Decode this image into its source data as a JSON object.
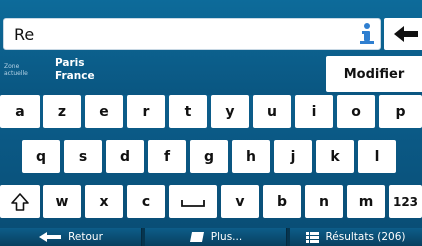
{
  "search": {
    "value": "Re"
  },
  "zone": {
    "label": "Zone actuelle",
    "city": "Paris",
    "country": "France"
  },
  "buttons": {
    "modify": "Modifier"
  },
  "keyboard": {
    "row1": [
      "a",
      "z",
      "e",
      "r",
      "t",
      "y",
      "u",
      "i",
      "o",
      "p"
    ],
    "row2": [
      "q",
      "s",
      "d",
      "f",
      "g",
      "h",
      "j",
      "k",
      "l"
    ],
    "row3": [
      "w",
      "x",
      "c",
      "v",
      "b",
      "n",
      "m"
    ],
    "numbers_key": "123"
  },
  "bottom_bar": {
    "back": "Retour",
    "more": "Plus...",
    "results": "Résultats (206)"
  },
  "colors": {
    "background": "#0b5a85",
    "key": "#ffffff",
    "bottom_bar": "#06354f"
  }
}
